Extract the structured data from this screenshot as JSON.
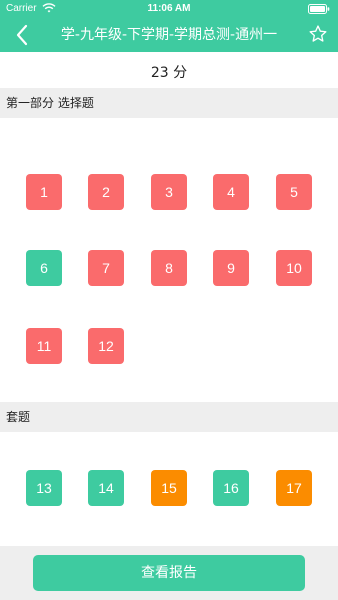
{
  "status_bar": {
    "carrier": "Carrier",
    "time": "11:06 AM"
  },
  "nav": {
    "title": "学-九年级-下学期-学期总测-通州一",
    "back_icon": "chevron-left-icon",
    "favorite_icon": "star-outline-icon"
  },
  "score": {
    "text": "23 分"
  },
  "sections": [
    {
      "title": "第一部分 选择题",
      "questions": [
        {
          "label": "1",
          "status": "wrong"
        },
        {
          "label": "2",
          "status": "wrong"
        },
        {
          "label": "3",
          "status": "wrong"
        },
        {
          "label": "4",
          "status": "wrong"
        },
        {
          "label": "5",
          "status": "wrong"
        },
        {
          "label": "6",
          "status": "right"
        },
        {
          "label": "7",
          "status": "wrong"
        },
        {
          "label": "8",
          "status": "wrong"
        },
        {
          "label": "9",
          "status": "wrong"
        },
        {
          "label": "10",
          "status": "wrong"
        },
        {
          "label": "11",
          "status": "wrong"
        },
        {
          "label": "12",
          "status": "wrong"
        }
      ]
    },
    {
      "title": "套题",
      "questions": [
        {
          "label": "13",
          "status": "right"
        },
        {
          "label": "14",
          "status": "right"
        },
        {
          "label": "15",
          "status": "partial"
        },
        {
          "label": "16",
          "status": "right"
        },
        {
          "label": "17",
          "status": "partial"
        }
      ]
    }
  ],
  "footer": {
    "report_button": "查看报告"
  },
  "colors": {
    "accent": "#3ecba0",
    "wrong": "#fa6b6c",
    "partial": "#fb8c00"
  }
}
